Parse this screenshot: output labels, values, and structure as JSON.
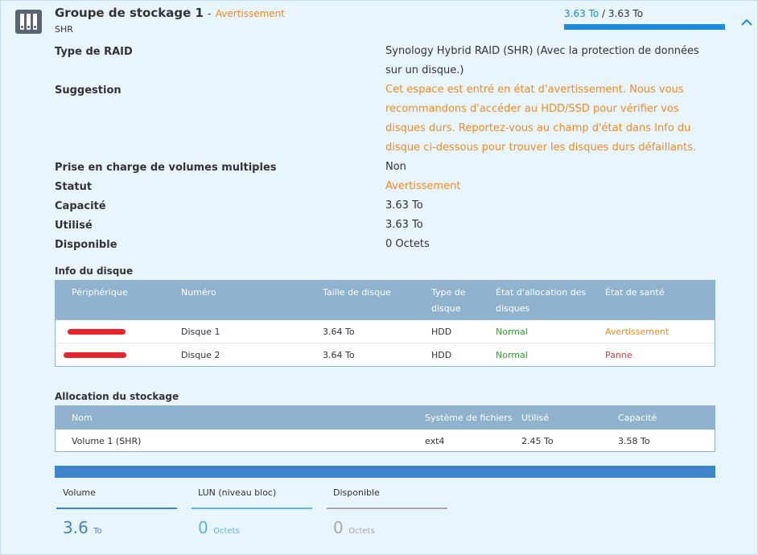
{
  "header": {
    "title": "Groupe de stockage 1",
    "separator": "-",
    "status": "Avertissement",
    "subtitle": "SHR",
    "used": "3.63 To",
    "slash": "/",
    "total": "3.63 To",
    "usage_fraction": 1.0
  },
  "details": [
    {
      "label": "Type de RAID",
      "value": "Synology Hybrid RAID (SHR) (Avec la protection de données sur un disque.)",
      "tone": "normal"
    },
    {
      "label": "Suggestion",
      "value": "Cet espace est entré en état d'avertissement. Nous vous recommandons d'accéder au HDD/SSD pour vérifier vos disques durs. Reportez-vous au champ d'état dans Info du disque ci-dessous pour trouver les disques durs défaillants.",
      "tone": "orange"
    },
    {
      "label": "Prise en charge de volumes multiples",
      "value": "Non",
      "tone": "normal"
    },
    {
      "label": "Statut",
      "value": "Avertissement",
      "tone": "orange"
    },
    {
      "label": "Capacité",
      "value": "3.63 To",
      "tone": "normal"
    },
    {
      "label": "Utilisé",
      "value": "3.63 To",
      "tone": "normal"
    },
    {
      "label": "Disponible",
      "value": "0 Octets",
      "tone": "normal"
    }
  ],
  "disk_info": {
    "title": "Info du disque",
    "columns": [
      "Périphérique",
      "Numéro",
      "Taille de disque",
      "Type de disque",
      "État d'allocation des disques",
      "État de santé"
    ],
    "rows": [
      {
        "device": "",
        "number": "Disque 1",
        "size": "3.64 To",
        "type": "HDD",
        "allocation": "Normal",
        "health": "Avertissement",
        "health_tone": "orange"
      },
      {
        "device": "",
        "number": "Disque 2",
        "size": "3.64 To",
        "type": "HDD",
        "allocation": "Normal",
        "health": "Panne",
        "health_tone": "red"
      }
    ]
  },
  "allocation": {
    "title": "Allocation du stockage",
    "columns": [
      "Nom",
      "Système de fichiers",
      "Utilisé",
      "Capacité"
    ],
    "rows": [
      {
        "name": "Volume 1 (SHR)",
        "fs": "ext4",
        "used": "2.45 To",
        "capacity": "3.58 To"
      }
    ]
  },
  "stats": [
    {
      "label": "Volume",
      "value": "3.6",
      "unit": "To",
      "color": "#3e86cc"
    },
    {
      "label": "LUN (niveau bloc)",
      "value": "0",
      "unit": "Octets",
      "color": "#5bb6e8"
    },
    {
      "label": "Disponible",
      "value": "0",
      "unit": "Octets",
      "color": "#a9a9a9"
    }
  ],
  "colors": {
    "accent": "#1a8be0",
    "warning": "#f58a1e",
    "error": "#e23b3b",
    "ok": "#2ea02e",
    "grid_header": "#8fb3cf"
  },
  "icons": {
    "storage": "storage-pool-icon",
    "collapse": "chevron-up-icon"
  }
}
